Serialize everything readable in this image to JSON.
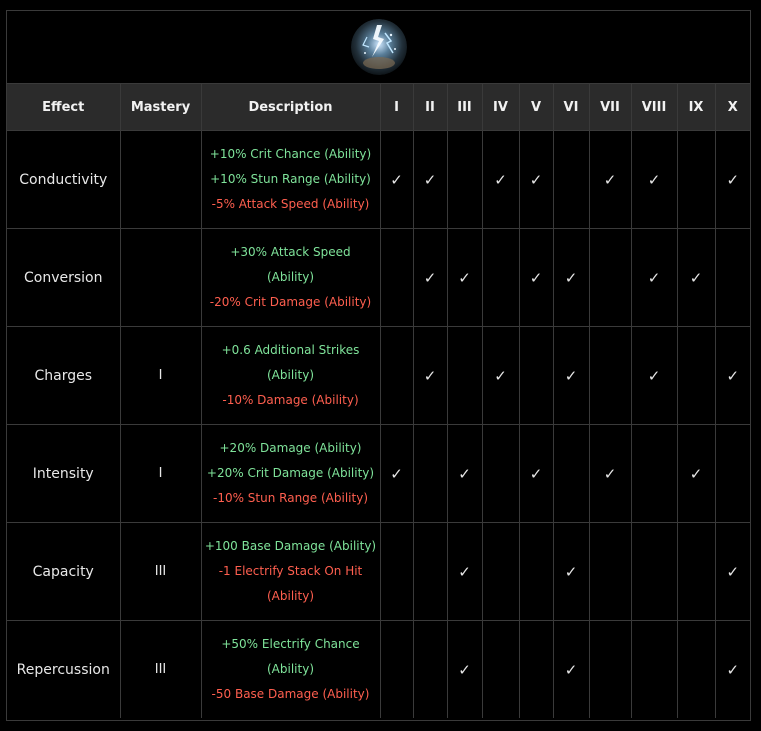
{
  "headers": {
    "effect": "Effect",
    "mastery": "Mastery",
    "description": "Description",
    "tiers": [
      "I",
      "II",
      "III",
      "IV",
      "V",
      "VI",
      "VII",
      "VIII",
      "IX",
      "X"
    ]
  },
  "check_glyph": "✓",
  "colors": {
    "positive": "#7fe39a",
    "negative": "#ff5f4f",
    "header_bg": "#2b2b2b",
    "border": "#3a3a3a",
    "background": "#000000"
  },
  "banner_icon": "electric-orb-icon",
  "rows": [
    {
      "effect": "Conductivity",
      "mastery": "",
      "desc": [
        {
          "text": "+10% Crit Chance (Ability)",
          "type": "pos"
        },
        {
          "text": "+10% Stun Range (Ability)",
          "type": "pos"
        },
        {
          "text": "-5% Attack Speed (Ability)",
          "type": "neg"
        }
      ],
      "checks": [
        true,
        true,
        false,
        true,
        true,
        false,
        true,
        true,
        false,
        true
      ]
    },
    {
      "effect": "Conversion",
      "mastery": "",
      "desc": [
        {
          "text": "+30% Attack Speed",
          "type": "pos"
        },
        {
          "text": "(Ability)",
          "type": "pos"
        },
        {
          "text": "-20% Crit Damage (Ability)",
          "type": "neg"
        }
      ],
      "checks": [
        false,
        true,
        true,
        false,
        true,
        true,
        false,
        true,
        true,
        false
      ]
    },
    {
      "effect": "Charges",
      "mastery": "I",
      "desc": [
        {
          "text": "+0.6 Additional Strikes",
          "type": "pos"
        },
        {
          "text": "(Ability)",
          "type": "pos"
        },
        {
          "text": "-10% Damage (Ability)",
          "type": "neg"
        }
      ],
      "checks": [
        false,
        true,
        false,
        true,
        false,
        true,
        false,
        true,
        false,
        true
      ]
    },
    {
      "effect": "Intensity",
      "mastery": "I",
      "desc": [
        {
          "text": "+20% Damage (Ability)",
          "type": "pos"
        },
        {
          "text": "+20% Crit Damage (Ability)",
          "type": "pos"
        },
        {
          "text": "-10% Stun Range (Ability)",
          "type": "neg"
        }
      ],
      "checks": [
        true,
        false,
        true,
        false,
        true,
        false,
        true,
        false,
        true,
        false
      ]
    },
    {
      "effect": "Capacity",
      "mastery": "III",
      "desc": [
        {
          "text": "+100 Base Damage (Ability)",
          "type": "pos"
        },
        {
          "text": "-1 Electrify Stack On Hit",
          "type": "neg"
        },
        {
          "text": "(Ability)",
          "type": "neg"
        }
      ],
      "checks": [
        false,
        false,
        true,
        false,
        false,
        true,
        false,
        false,
        false,
        true
      ]
    },
    {
      "effect": "Repercussion",
      "mastery": "III",
      "desc": [
        {
          "text": "+50% Electrify Chance",
          "type": "pos"
        },
        {
          "text": "(Ability)",
          "type": "pos"
        },
        {
          "text": "-50 Base Damage (Ability)",
          "type": "neg"
        }
      ],
      "checks": [
        false,
        false,
        true,
        false,
        false,
        true,
        false,
        false,
        false,
        true
      ]
    }
  ]
}
